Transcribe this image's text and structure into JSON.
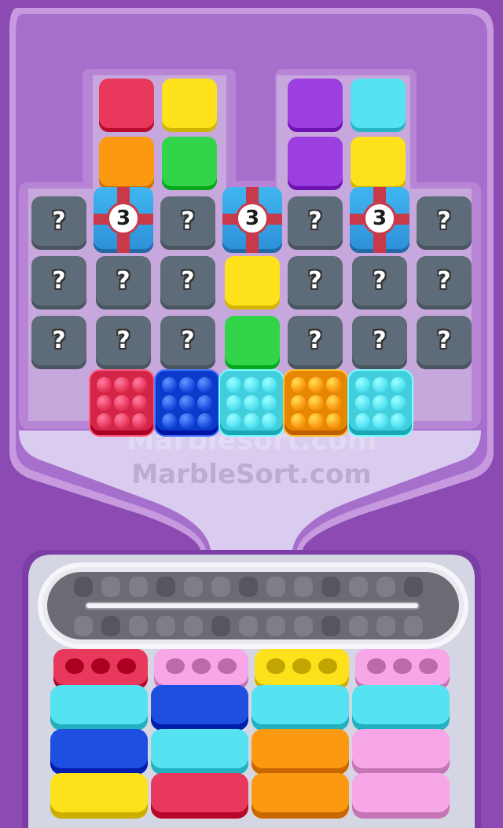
{
  "watermark": {
    "line1": "Marblesort.com",
    "line2": "MarbleSort.com"
  },
  "question_label": "?",
  "gift_count": "3",
  "colors": {
    "red": "#e8385c",
    "yellow": "#fde11a",
    "purple": "#9b3fe0",
    "cyan": "#55e3f2",
    "orange": "#fb9a10",
    "green": "#32d44a",
    "blue": "#1e4fe0",
    "pink": "#f7a6e8",
    "darkred": "#dd2750"
  },
  "board": {
    "top_tiles": [
      "red",
      "yellow",
      "purple",
      "cyan",
      "orange",
      "green",
      "purple",
      "yellow"
    ],
    "row1": [
      "q",
      "gift",
      "q",
      "gift",
      "q",
      "gift",
      "q"
    ],
    "row2": [
      "q",
      "q",
      "q",
      "yellow",
      "q",
      "q",
      "q"
    ],
    "row3": [
      "q",
      "q",
      "q",
      "green",
      "q",
      "q",
      "q"
    ],
    "marble_boxes": [
      "red",
      "blue",
      "cyan",
      "orange",
      "cyan"
    ]
  },
  "conveyor": {
    "slots_total": 24,
    "filled": 0
  },
  "containers": [
    {
      "top": "red",
      "stack": [
        "cyan",
        "blue",
        "yellow"
      ]
    },
    {
      "top": "pink",
      "stack": [
        "blue",
        "cyan",
        "red"
      ]
    },
    {
      "top": "yellow",
      "stack": [
        "cyan",
        "orange",
        "orange"
      ]
    },
    {
      "top": "pink",
      "stack": [
        "cyan",
        "pink",
        "pink"
      ]
    }
  ]
}
